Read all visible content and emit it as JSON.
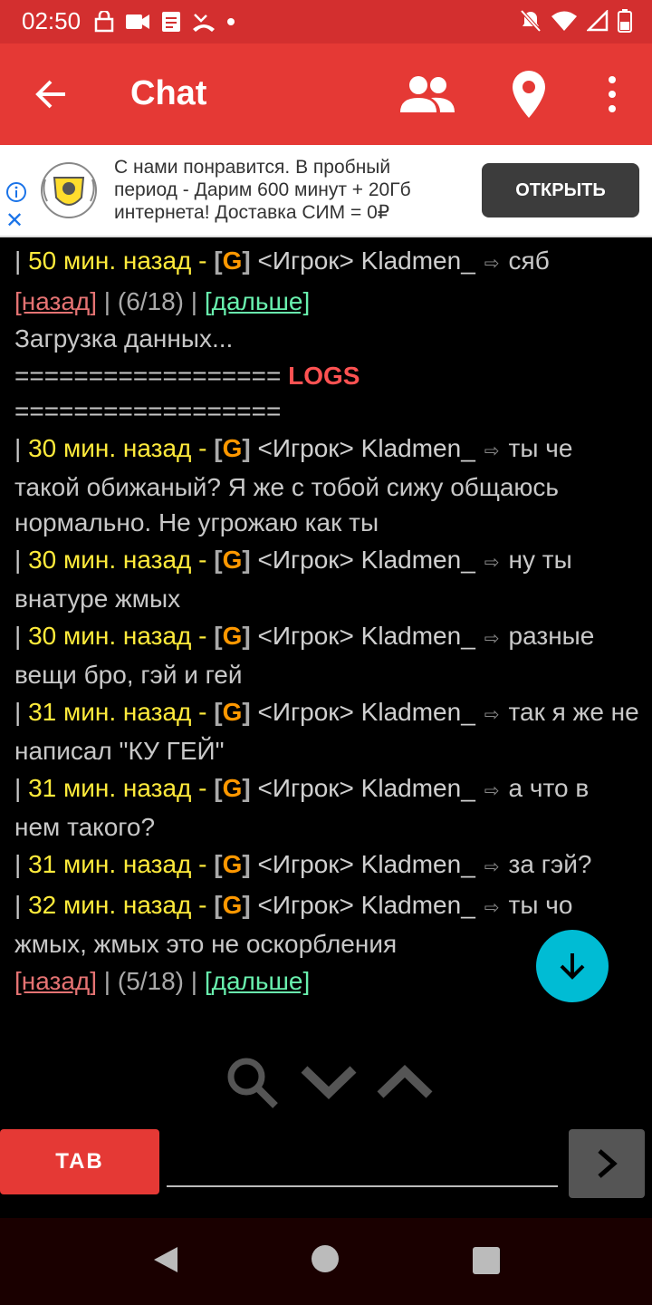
{
  "status_bar": {
    "time": "02:50"
  },
  "app_bar": {
    "title": "Chat"
  },
  "ad": {
    "text": "С нами понравится. В пробный период - Дарим 600 минут + 20Гб интернета! Доставка СИМ = 0₽",
    "button": "ОТКРЫТЬ"
  },
  "chat": {
    "line1": {
      "pipe": "| ",
      "time": "50 мин. назад - ",
      "lb": "[",
      "g": "G",
      "rb": "]",
      "nick": " <Игрок> Kladmen_",
      "arrow": "⇨",
      "msg": "сяб"
    },
    "pager1": {
      "prev": "[назад]",
      "info": " | (6/18) | ",
      "next": "[дальше]"
    },
    "loading": "Загрузка данных...",
    "logs_sep": "================== ",
    "logs_label": "LOGS",
    "logs_sep2": "==================",
    "messages": [
      {
        "pipe": "| ",
        "time": "30 мин. назад - ",
        "lb": "[",
        "g": "G",
        "rb": "]",
        "nick": " <Игрок> Kladmen_",
        "arrow": "⇨",
        "msg": "ты че такой обижаный? Я же с тобой сижу общаюсь нормально. Не угрожаю как ты"
      },
      {
        "pipe": "| ",
        "time": "30 мин. назад - ",
        "lb": "[",
        "g": "G",
        "rb": "]",
        "nick": " <Игрок> Kladmen_",
        "arrow": "⇨",
        "msg": "ну ты внатуре жмых"
      },
      {
        "pipe": "| ",
        "time": "30 мин. назад - ",
        "lb": "[",
        "g": "G",
        "rb": "]",
        "nick": " <Игрок> Kladmen_",
        "arrow": "⇨",
        "msg": "разные вещи бро, гэй и гей"
      },
      {
        "pipe": "| ",
        "time": "31 мин. назад - ",
        "lb": "[",
        "g": "G",
        "rb": "]",
        "nick": " <Игрок> Kladmen_",
        "arrow": "⇨",
        "msg": "так я же не написал \"КУ ГЕЙ\""
      },
      {
        "pipe": "| ",
        "time": "31 мин. назад - ",
        "lb": "[",
        "g": "G",
        "rb": "]",
        "nick": " <Игрок> Kladmen_",
        "arrow": "⇨",
        "msg": "а что в нем такого?"
      },
      {
        "pipe": "| ",
        "time": "31 мин. назад - ",
        "lb": "[",
        "g": "G",
        "rb": "]",
        "nick": " <Игрок> Kladmen_",
        "arrow": "⇨",
        "msg": "за гэй?"
      },
      {
        "pipe": "| ",
        "time": "32 мин. назад - ",
        "lb": "[",
        "g": "G",
        "rb": "]",
        "nick": " <Игрок> Kladmen_",
        "arrow": "⇨",
        "msg": "ты чо жмых, жмых это не оскорбления"
      }
    ],
    "pager2": {
      "prev": "[назад]",
      "info": " | (5/18) | ",
      "next": "[дальше]"
    }
  },
  "bottom": {
    "tab_label": "TAB",
    "input_value": ""
  },
  "colors": {
    "primary": "#e53935",
    "fab": "#00bcd4",
    "time": "#ffeb3b",
    "tag": "#ff9800",
    "prev": "#e57373",
    "next": "#69f0ae",
    "logs": "#ff5252"
  }
}
